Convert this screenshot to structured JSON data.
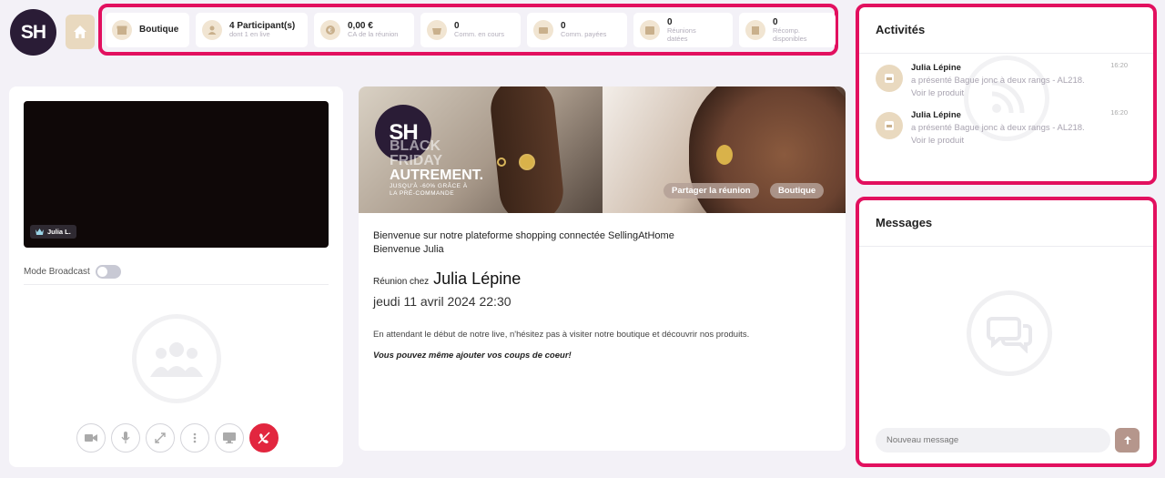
{
  "header": {
    "logo_text": "SH",
    "stats": [
      {
        "value": "Boutique",
        "label": "",
        "icon": "store-icon"
      },
      {
        "value": "4 Participant(s)",
        "label": "dont 1 en live",
        "icon": "user-icon"
      },
      {
        "value": "0,00 €",
        "label": "CA de la réunion",
        "icon": "euro-icon"
      },
      {
        "value": "0",
        "label": "Comm. en cours",
        "icon": "basket-icon"
      },
      {
        "value": "0",
        "label": "Comm. payées",
        "icon": "card-icon"
      },
      {
        "value": "0",
        "label": "Réunions\ndatées",
        "icon": "calendar-icon"
      },
      {
        "value": "0",
        "label": "Récomp.\ndisponibles",
        "icon": "gift-icon"
      }
    ]
  },
  "activities": {
    "title": "Activités",
    "items": [
      {
        "name": "Julia Lépine",
        "desc": "a présenté Bague jonc à deux rangs - AL218.",
        "link": "Voir le produit",
        "time": "16:20"
      },
      {
        "name": "Julia Lépine",
        "desc": "a présenté Bague jonc à deux rangs - AL218.",
        "link": "Voir le produit",
        "time": "16:20"
      }
    ]
  },
  "messages": {
    "title": "Messages",
    "input_placeholder": "Nouveau message"
  },
  "video": {
    "badge": "Julia L.",
    "broadcast_label": "Mode Broadcast",
    "controls": [
      "camera-icon",
      "microphone-icon",
      "fullscreen-icon",
      "more-icon",
      "screen-share-icon",
      "hangup-icon"
    ]
  },
  "main": {
    "banner": {
      "logo": "SH",
      "headline": [
        "BLACK",
        "FRIDAY",
        "AUTREMENT.",
        "JUSQU'À -60% GRÂCE À",
        "LA PRÉ-COMMANDE"
      ],
      "share_button": "Partager la réunion",
      "shop_button": "Boutique"
    },
    "welcome_line1": "Bienvenue sur notre plateforme shopping connectée SellingAtHome",
    "welcome_line2": "Bienvenue Julia",
    "host_prefix": "Réunion chez",
    "host_name": "Julia Lépine",
    "date": "jeudi 11 avril 2024 22:30",
    "intro": "En attendant le début de notre live, n'hésitez pas à visiter notre boutique et découvrir nos produits.",
    "cta": "Vous pouvez même ajouter vos coups de coeur!"
  },
  "colors": {
    "highlight": "#e2105f",
    "brand_dark": "#2a1c36",
    "accent_beige": "#e9d9bf",
    "hangup": "#e2263f"
  }
}
